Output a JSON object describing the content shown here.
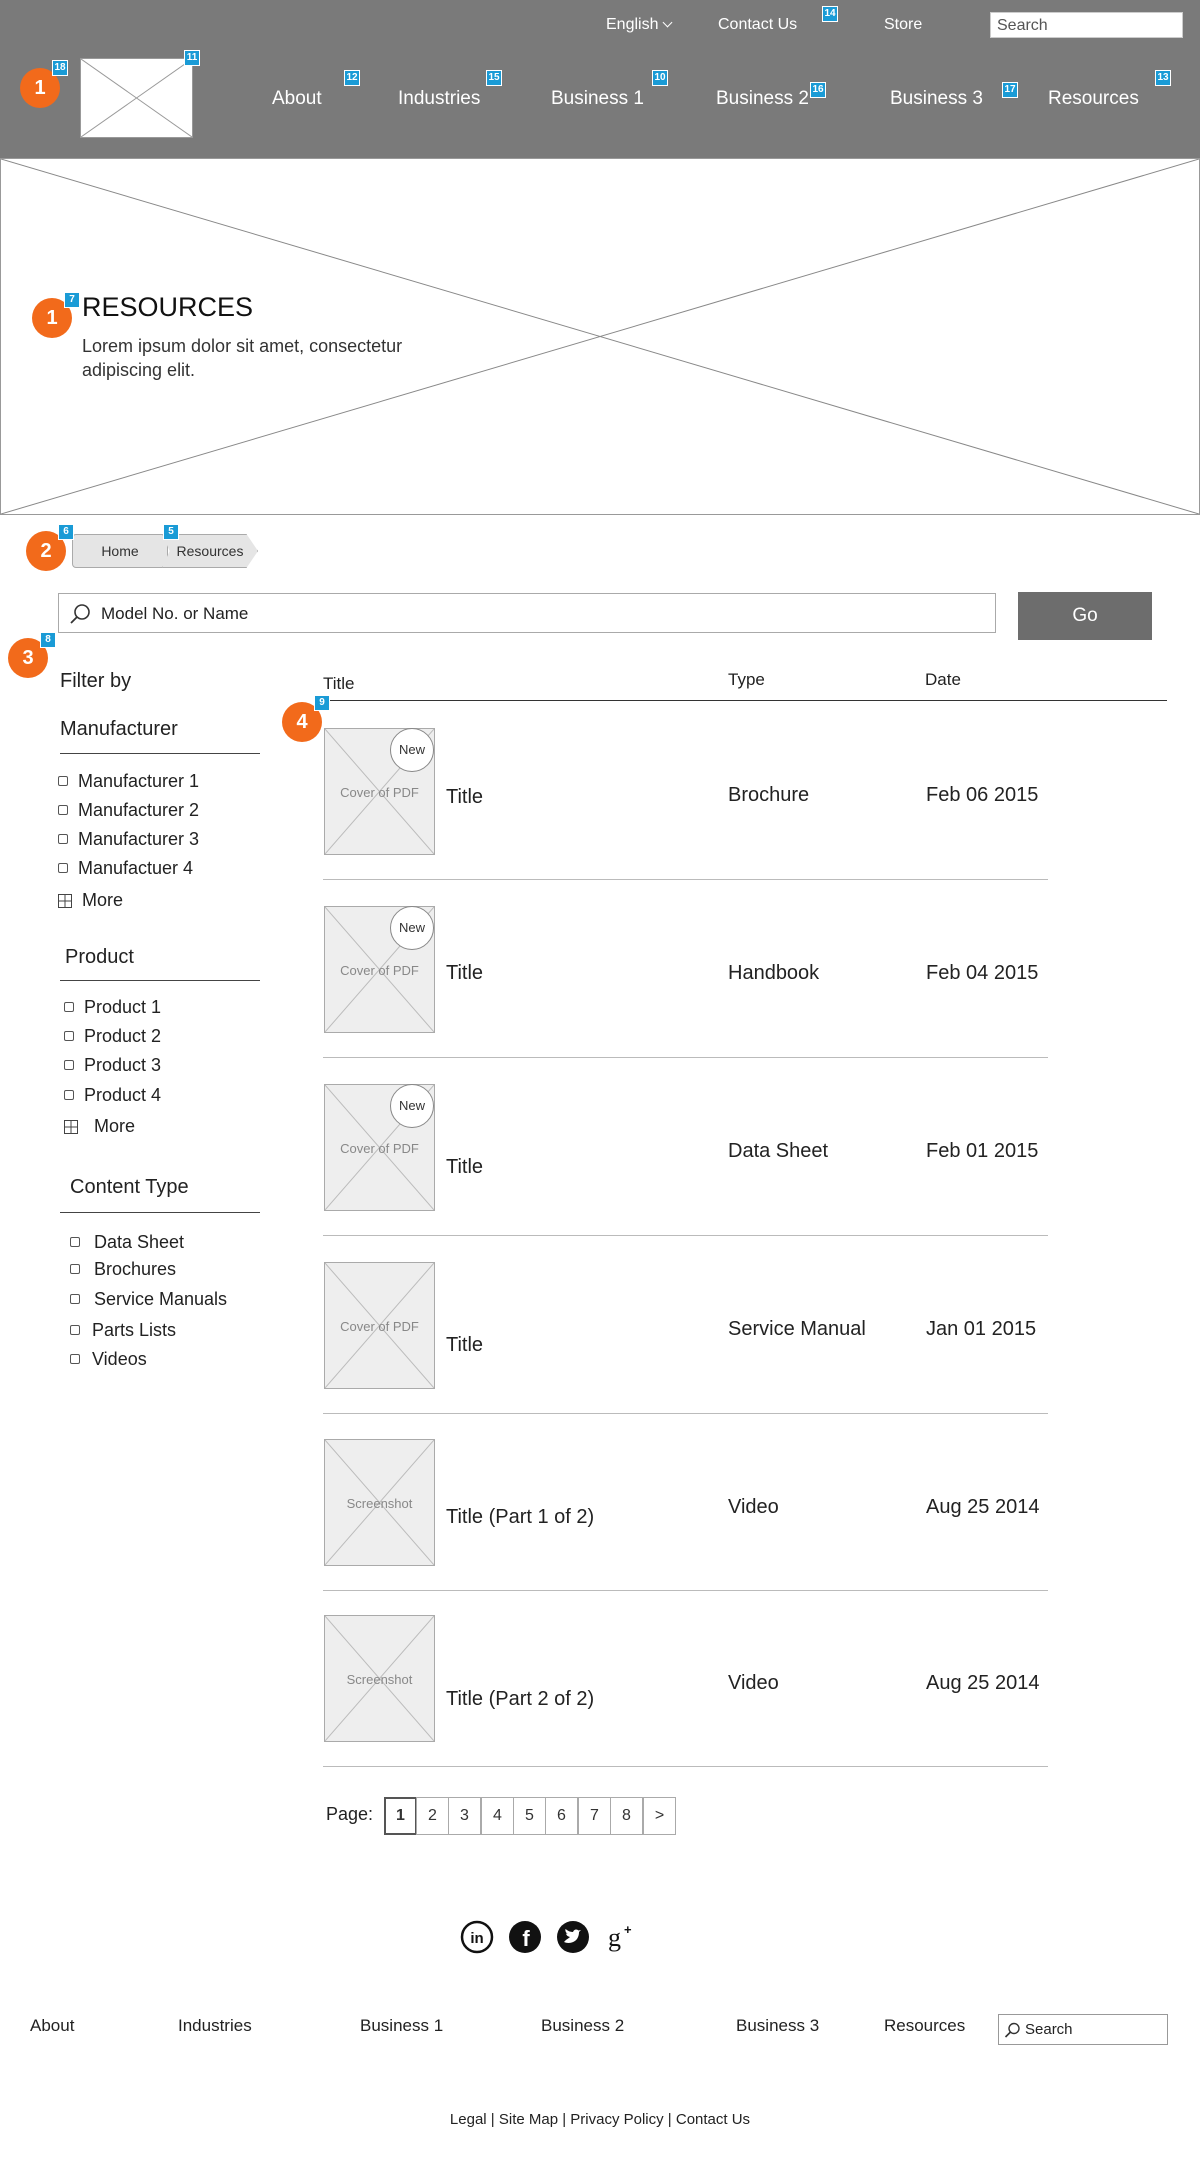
{
  "header": {
    "language": "English",
    "contact": "Contact Us",
    "store": "Store",
    "search_placeholder": "Search",
    "nav": [
      "About",
      "Industries",
      "Business 1",
      "Business 2",
      "Business 3",
      "Resources"
    ]
  },
  "annotations": {
    "markers": [
      "1",
      "1",
      "2",
      "3",
      "4"
    ],
    "numbers": {
      "logo_left": "18",
      "logo": "11",
      "about": "12",
      "industries": "15",
      "business1": "10",
      "business2": "16",
      "business3": "17",
      "resources": "13",
      "contact": "14",
      "hero": "7",
      "home": "6",
      "crumb_resources": "5",
      "filter": "8",
      "results": "9"
    }
  },
  "hero": {
    "title": "RESOURCES",
    "text": "Lorem ipsum dolor sit amet, consectetur adipiscing elit."
  },
  "breadcrumb": [
    "Home",
    "Resources"
  ],
  "search": {
    "placeholder": "Model No. or Name",
    "button": "Go"
  },
  "filters": {
    "title": "Filter by",
    "groups": [
      {
        "name": "Manufacturer",
        "items": [
          "Manufacturer 1",
          "Manufacturer 2",
          "Manufacturer 3",
          "Manufactuer 4"
        ],
        "more": "More"
      },
      {
        "name": "Product",
        "items": [
          "Product 1",
          "Product 2",
          "Product 3",
          "Product 4"
        ],
        "more": "More"
      },
      {
        "name": "Content Type",
        "items": [
          "Data Sheet",
          "Brochures",
          "Service Manuals",
          "Parts Lists",
          "Videos"
        ]
      }
    ]
  },
  "table": {
    "headers": [
      "Title",
      "Type",
      "Date"
    ],
    "new_badge": "New",
    "rows": [
      {
        "thumb": "Cover of PDF",
        "title": "Title",
        "type": "Brochure",
        "date": "Feb 06 2015",
        "is_new": true
      },
      {
        "thumb": "Cover of PDF",
        "title": "Title",
        "type": "Handbook",
        "date": "Feb 04 2015",
        "is_new": true
      },
      {
        "thumb": "Cover of PDF",
        "title": "Title",
        "type": "Data Sheet",
        "date": "Feb 01 2015",
        "is_new": true
      },
      {
        "thumb": "Cover of PDF",
        "title": "Title",
        "type": "Service Manual",
        "date": "Jan 01 2015",
        "is_new": false
      },
      {
        "thumb": "Screenshot",
        "title": "Title  (Part 1 of 2)",
        "type": "Video",
        "date": "Aug 25 2014",
        "is_new": false
      },
      {
        "thumb": "Screenshot",
        "title": "Title (Part 2 of 2)",
        "type": "Video",
        "date": "Aug 25 2014",
        "is_new": false
      }
    ]
  },
  "pager": {
    "label": "Page:",
    "pages": [
      "1",
      "2",
      "3",
      "4",
      "5",
      "6",
      "7",
      "8",
      ">"
    ],
    "current": "1"
  },
  "social": [
    "linkedin-icon",
    "facebook-icon",
    "twitter-icon",
    "google-plus-icon"
  ],
  "footer": {
    "links": [
      "About",
      "Industries",
      "Business 1",
      "Business 2",
      "Business 3",
      "Resources"
    ],
    "search_placeholder": "Search",
    "legal": "Legal  | Site Map | Privacy Policy | Contact Us"
  }
}
